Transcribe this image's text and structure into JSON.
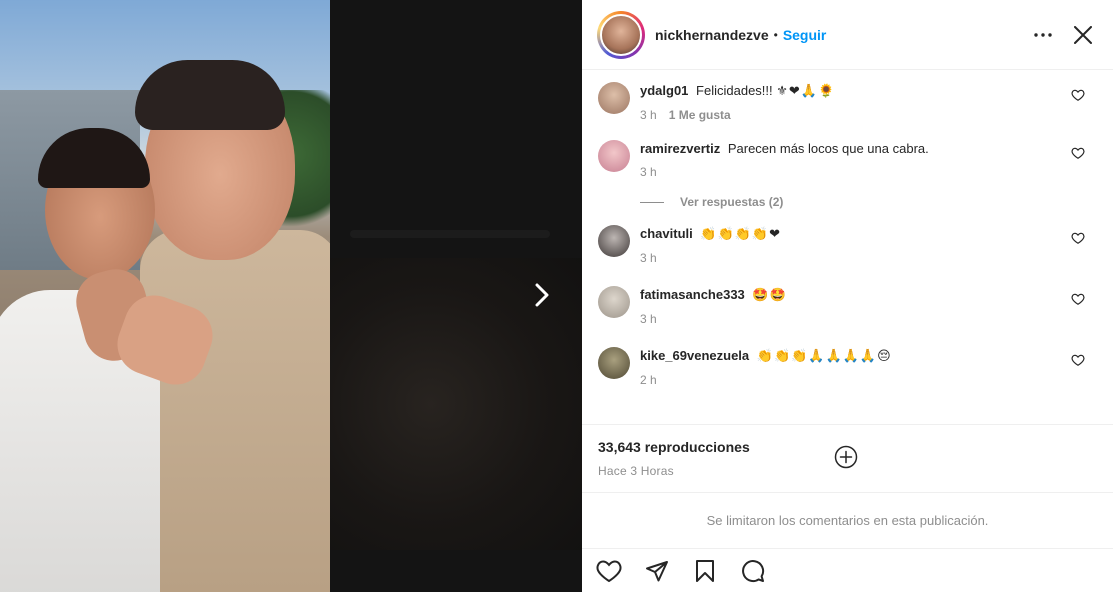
{
  "header": {
    "username": "nickhernandezve",
    "dot": "•",
    "follow_label": "Seguir"
  },
  "comments": [
    {
      "username": "ydalg01",
      "text": "Felicidades!!!",
      "emojis": "⚜❤🙏🌻",
      "time": "3 h",
      "likes": "1 Me gusta",
      "avatar_color": "#c9a48e"
    },
    {
      "username": "ramirezvertiz",
      "text": "Parecen más locos que una cabra.",
      "emojis": "",
      "time": "3 h",
      "likes": "",
      "avatar_color": "#d9a7b8"
    },
    {
      "username": "chavituli",
      "text": "",
      "emojis": "👏👏👏👏❤",
      "time": "3 h",
      "likes": "",
      "avatar_color": "#6f6a6a"
    },
    {
      "username": "fatimasanche333",
      "text": "",
      "emojis": "🤩🤩",
      "time": "3 h",
      "likes": "",
      "avatar_color": "#b8b1a6"
    },
    {
      "username": "kike_69venezuela",
      "text": "",
      "emojis": "👏👏👏🙏🙏🙏🙏😔",
      "time": "2 h",
      "likes": "",
      "avatar_color": "#7a6d4f"
    }
  ],
  "view_replies_label": "Ver respuestas (2)",
  "stats": {
    "views": "33,643 reproducciones",
    "time_ago": "Hace 3 Horas"
  },
  "limited_comments_notice": "Se limitaron los comentarios en esta publicación.",
  "colors": {
    "accent": "#0095f6",
    "text": "#262626",
    "secondary": "#8e8e8e",
    "heart_red": "#ed4956"
  }
}
